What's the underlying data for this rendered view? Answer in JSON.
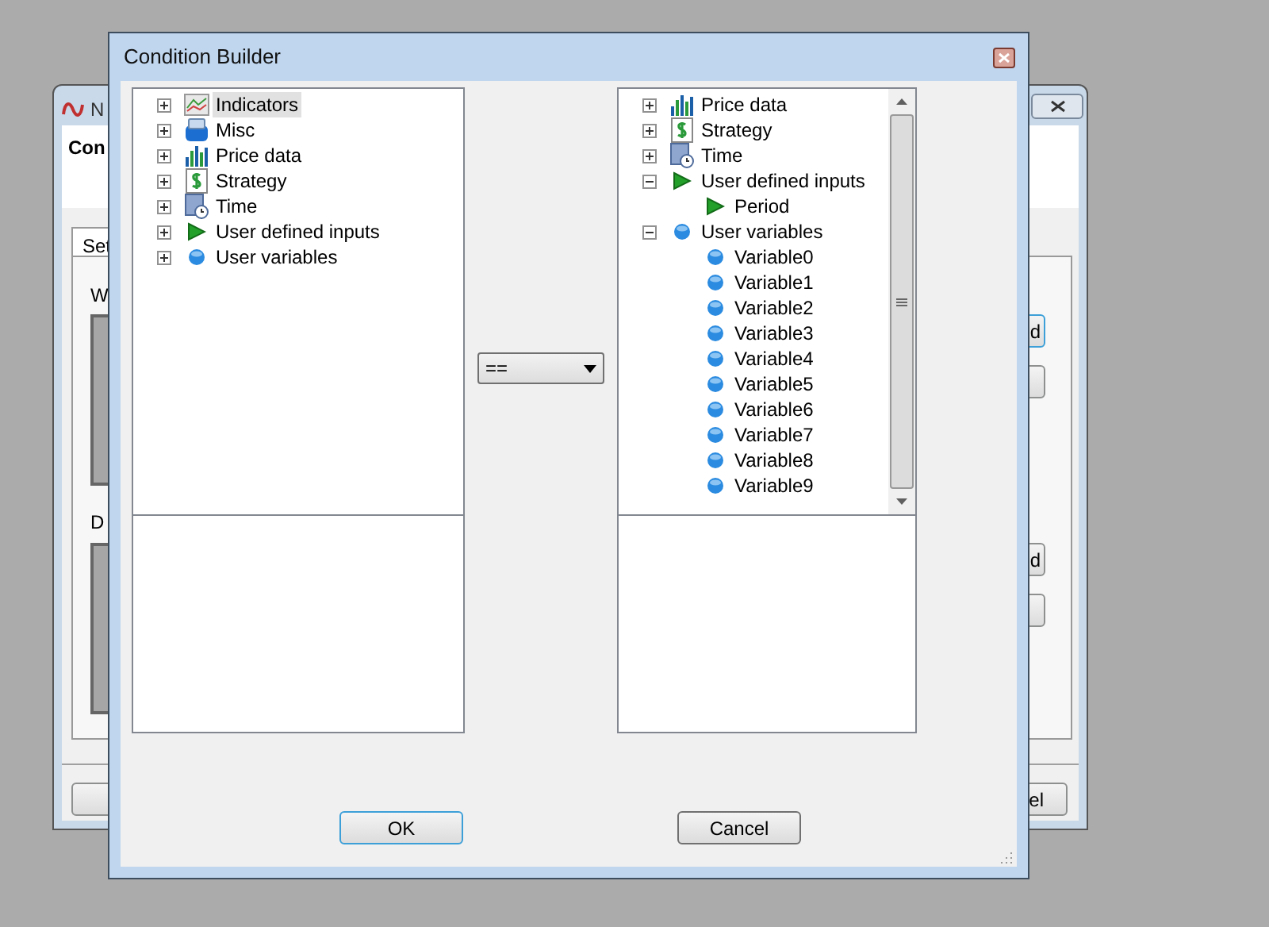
{
  "background_window": {
    "title": "N",
    "heading": "Con",
    "tab": "Set",
    "label_1": "W",
    "label_2": "D",
    "right_buttons": [
      {
        "label": "d",
        "focused": true
      },
      {
        "label": "d",
        "focused": false
      }
    ],
    "bottom_button": "el"
  },
  "dialog": {
    "title": "Condition Builder",
    "left_tree": [
      {
        "label": "Indicators",
        "kind": "indicators",
        "expanded": false,
        "selected": true
      },
      {
        "label": "Misc",
        "kind": "misc",
        "expanded": false,
        "selected": false
      },
      {
        "label": "Price data",
        "kind": "price",
        "expanded": false,
        "selected": false
      },
      {
        "label": "Strategy",
        "kind": "strategy",
        "expanded": false,
        "selected": false
      },
      {
        "label": "Time",
        "kind": "time",
        "expanded": false,
        "selected": false
      },
      {
        "label": "User defined inputs",
        "kind": "input",
        "expanded": false,
        "selected": false
      },
      {
        "label": "User variables",
        "kind": "variable",
        "expanded": false,
        "selected": false
      }
    ],
    "operator": {
      "value": "=="
    },
    "right_tree": [
      {
        "label": "Price data",
        "kind": "price",
        "expanded": false,
        "selected": false
      },
      {
        "label": "Strategy",
        "kind": "strategy",
        "expanded": false,
        "selected": false
      },
      {
        "label": "Time",
        "kind": "time",
        "expanded": false,
        "selected": false
      },
      {
        "label": "User defined inputs",
        "kind": "input",
        "expanded": true,
        "selected": false,
        "children": [
          {
            "label": "Period",
            "kind": "input",
            "selected": false
          }
        ]
      },
      {
        "label": "User variables",
        "kind": "variable",
        "expanded": true,
        "selected": false,
        "children": [
          {
            "label": "Variable0",
            "kind": "variable",
            "selected": false
          },
          {
            "label": "Variable1",
            "kind": "variable",
            "selected": false
          },
          {
            "label": "Variable2",
            "kind": "variable",
            "selected": false
          },
          {
            "label": "Variable3",
            "kind": "variable",
            "selected": false
          },
          {
            "label": "Variable4",
            "kind": "variable",
            "selected": false
          },
          {
            "label": "Variable5",
            "kind": "variable",
            "selected": false
          },
          {
            "label": "Variable6",
            "kind": "variable",
            "selected": false
          },
          {
            "label": "Variable7",
            "kind": "variable",
            "selected": false
          },
          {
            "label": "Variable8",
            "kind": "variable",
            "selected": false
          },
          {
            "label": "Variable9",
            "kind": "variable",
            "selected": false
          }
        ]
      }
    ],
    "buttons": [
      {
        "label": "OK",
        "kind": "default"
      },
      {
        "label": "Cancel",
        "kind": "normal"
      }
    ]
  }
}
